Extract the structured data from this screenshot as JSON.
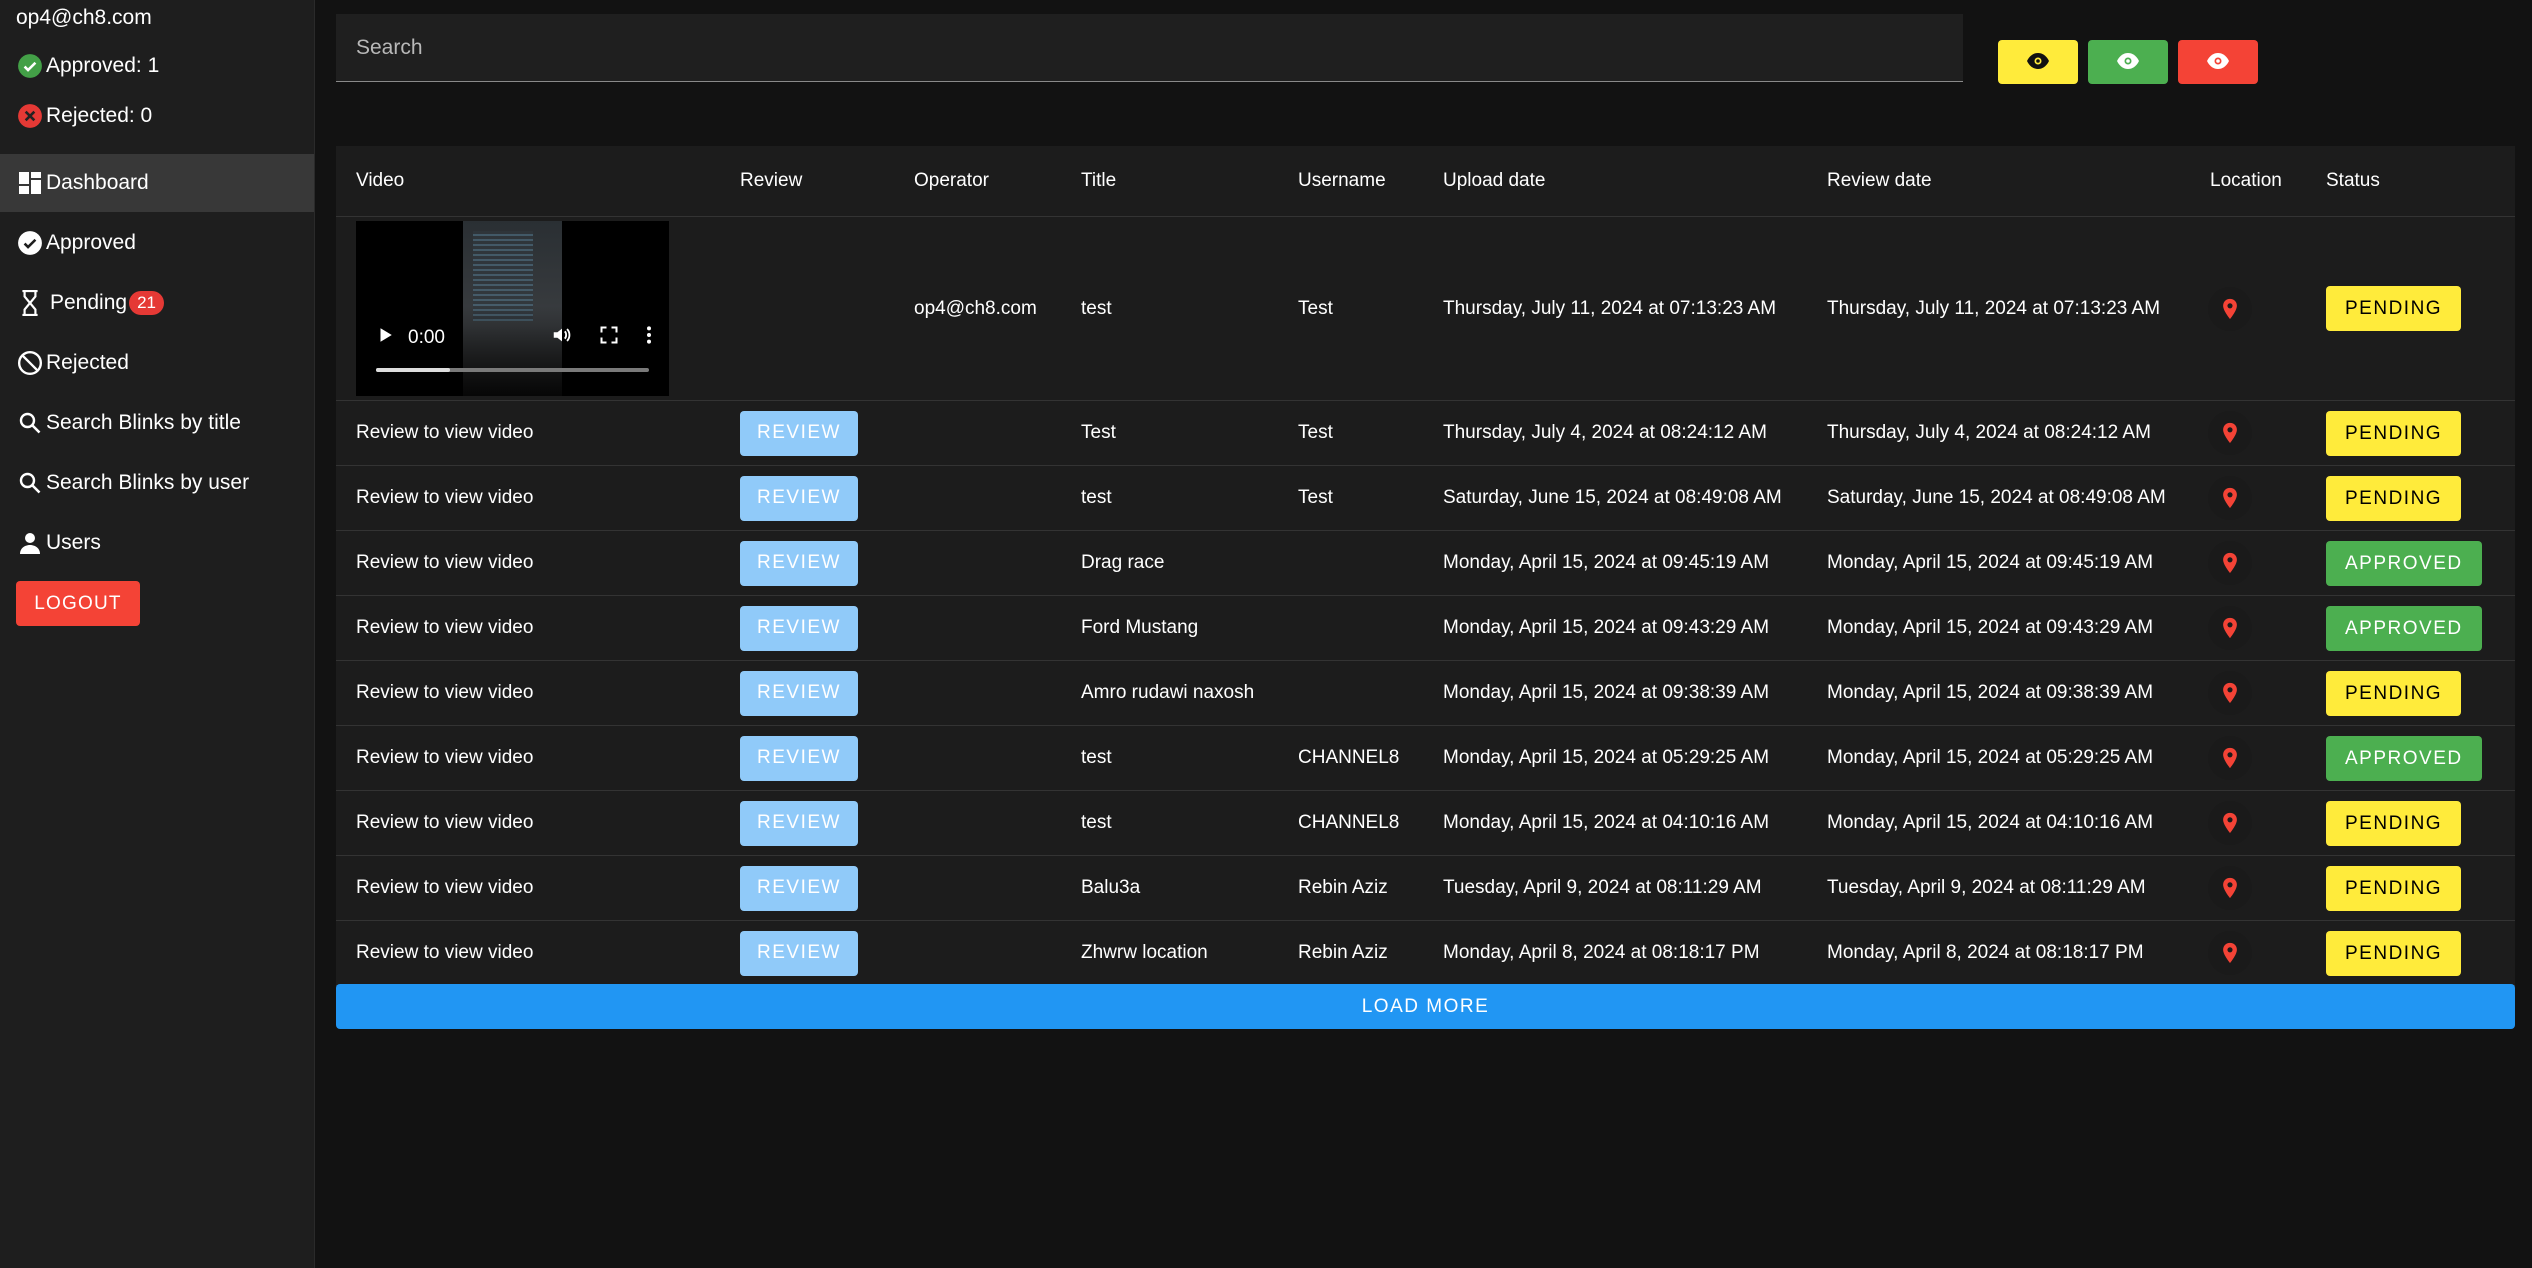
{
  "sidebar": {
    "email": "op4@ch8.com",
    "approved_label": "Approved: 1",
    "rejected_label": "Rejected: 0",
    "items": [
      {
        "label": "Dashboard",
        "icon": "dashboard-icon"
      },
      {
        "label": "Approved",
        "icon": "check-circle-icon"
      },
      {
        "label": "Pending",
        "icon": "hourglass-icon",
        "badge": "21"
      },
      {
        "label": "Rejected",
        "icon": "block-icon"
      },
      {
        "label": "Search Blinks by title",
        "icon": "search-icon"
      },
      {
        "label": "Search Blinks by user",
        "icon": "search-icon"
      },
      {
        "label": "Users",
        "icon": "person-icon"
      }
    ],
    "logout_label": "LOGOUT"
  },
  "search": {
    "placeholder": "Search"
  },
  "filters": {
    "colors": {
      "pending": "#ffeb3b",
      "approved": "#4caf50",
      "rejected": "#f44336"
    }
  },
  "table": {
    "headers": [
      "Video",
      "Review",
      "Operator",
      "Title",
      "Username",
      "Upload date",
      "Review date",
      "Location",
      "Status"
    ],
    "video_player": {
      "time": "0:00",
      "progress": 0.27
    },
    "review_label": "REVIEW",
    "view_video_text": "Review to view video",
    "rows": [
      {
        "operator": "op4@ch8.com",
        "title": "test",
        "username": "Test",
        "upload": "Thursday, July 11, 2024 at 07:13:23 AM",
        "review": "Thursday, July 11, 2024 at 07:13:23 AM",
        "status": "PENDING"
      },
      {
        "operator": "",
        "title": "Test",
        "username": "Test",
        "upload": "Thursday, July 4, 2024 at 08:24:12 AM",
        "review": "Thursday, July 4, 2024 at 08:24:12 AM",
        "status": "PENDING"
      },
      {
        "operator": "",
        "title": "test",
        "username": "Test",
        "upload": "Saturday, June 15, 2024 at 08:49:08 AM",
        "review": "Saturday, June 15, 2024 at 08:49:08 AM",
        "status": "PENDING"
      },
      {
        "operator": "",
        "title": "Drag race",
        "username": "",
        "upload": "Monday, April 15, 2024 at 09:45:19 AM",
        "review": "Monday, April 15, 2024 at 09:45:19 AM",
        "status": "APPROVED"
      },
      {
        "operator": "",
        "title": "Ford Mustang",
        "username": "",
        "upload": "Monday, April 15, 2024 at 09:43:29 AM",
        "review": "Monday, April 15, 2024 at 09:43:29 AM",
        "status": "APPROVED"
      },
      {
        "operator": "",
        "title": "Amro rudawi naxosh",
        "username": "",
        "upload": "Monday, April 15, 2024 at 09:38:39 AM",
        "review": "Monday, April 15, 2024 at 09:38:39 AM",
        "status": "PENDING"
      },
      {
        "operator": "",
        "title": "test",
        "username": "CHANNEL8",
        "upload": "Monday, April 15, 2024 at 05:29:25 AM",
        "review": "Monday, April 15, 2024 at 05:29:25 AM",
        "status": "APPROVED"
      },
      {
        "operator": "",
        "title": "test",
        "username": "CHANNEL8",
        "upload": "Monday, April 15, 2024 at 04:10:16 AM",
        "review": "Monday, April 15, 2024 at 04:10:16 AM",
        "status": "PENDING"
      },
      {
        "operator": "",
        "title": "Balu3a",
        "username": "Rebin Aziz",
        "upload": "Tuesday, April 9, 2024 at 08:11:29 AM",
        "review": "Tuesday, April 9, 2024 at 08:11:29 AM",
        "status": "PENDING"
      },
      {
        "operator": "",
        "title": "Zhwrw location",
        "username": "Rebin Aziz",
        "upload": "Monday, April 8, 2024 at 08:18:17 PM",
        "review": "Monday, April 8, 2024 at 08:18:17 PM",
        "status": "PENDING"
      }
    ]
  },
  "load_more_label": "LOAD MORE"
}
